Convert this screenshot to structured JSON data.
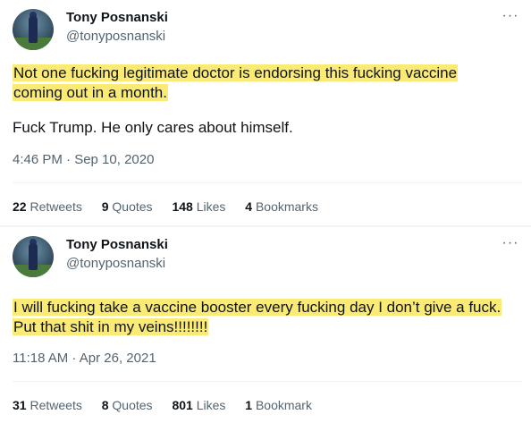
{
  "tweets": [
    {
      "author_name": "Tony Posnanski",
      "handle": "@tonyposnanski",
      "more_icon": "more-dots-icon",
      "text_line1": "Not one fucking legitimate doctor is endorsing this fucking vaccine",
      "text_line2": "coming out in a month.",
      "text_line3": "Fuck Trump. He only cares about himself.",
      "timestamp": "4:46 PM · Sep 10, 2020",
      "retweets_count": "22",
      "retweets_label": "Retweets",
      "quotes_count": "9",
      "quotes_label": "Quotes",
      "likes_count": "148",
      "likes_label": "Likes",
      "bookmarks_count": "4",
      "bookmarks_label": "Bookmarks"
    },
    {
      "author_name": "Tony Posnanski",
      "handle": "@tonyposnanski",
      "more_icon": "more-dots-icon",
      "text_line1": "I will fucking take a vaccine booster every fucking day I don’t give a fuck.",
      "text_line2": "Put that shit in my veins!!!!!!!!",
      "timestamp": "11:18 AM · Apr 26, 2021",
      "retweets_count": "31",
      "retweets_label": "Retweets",
      "quotes_count": "8",
      "quotes_label": "Quotes",
      "likes_count": "801",
      "likes_label": "Likes",
      "bookmarks_count": "1",
      "bookmarks_label": "Bookmark"
    }
  ],
  "colors": {
    "highlight": "#fbea73",
    "secondary_text": "#536471",
    "primary_text": "#0f1419"
  }
}
